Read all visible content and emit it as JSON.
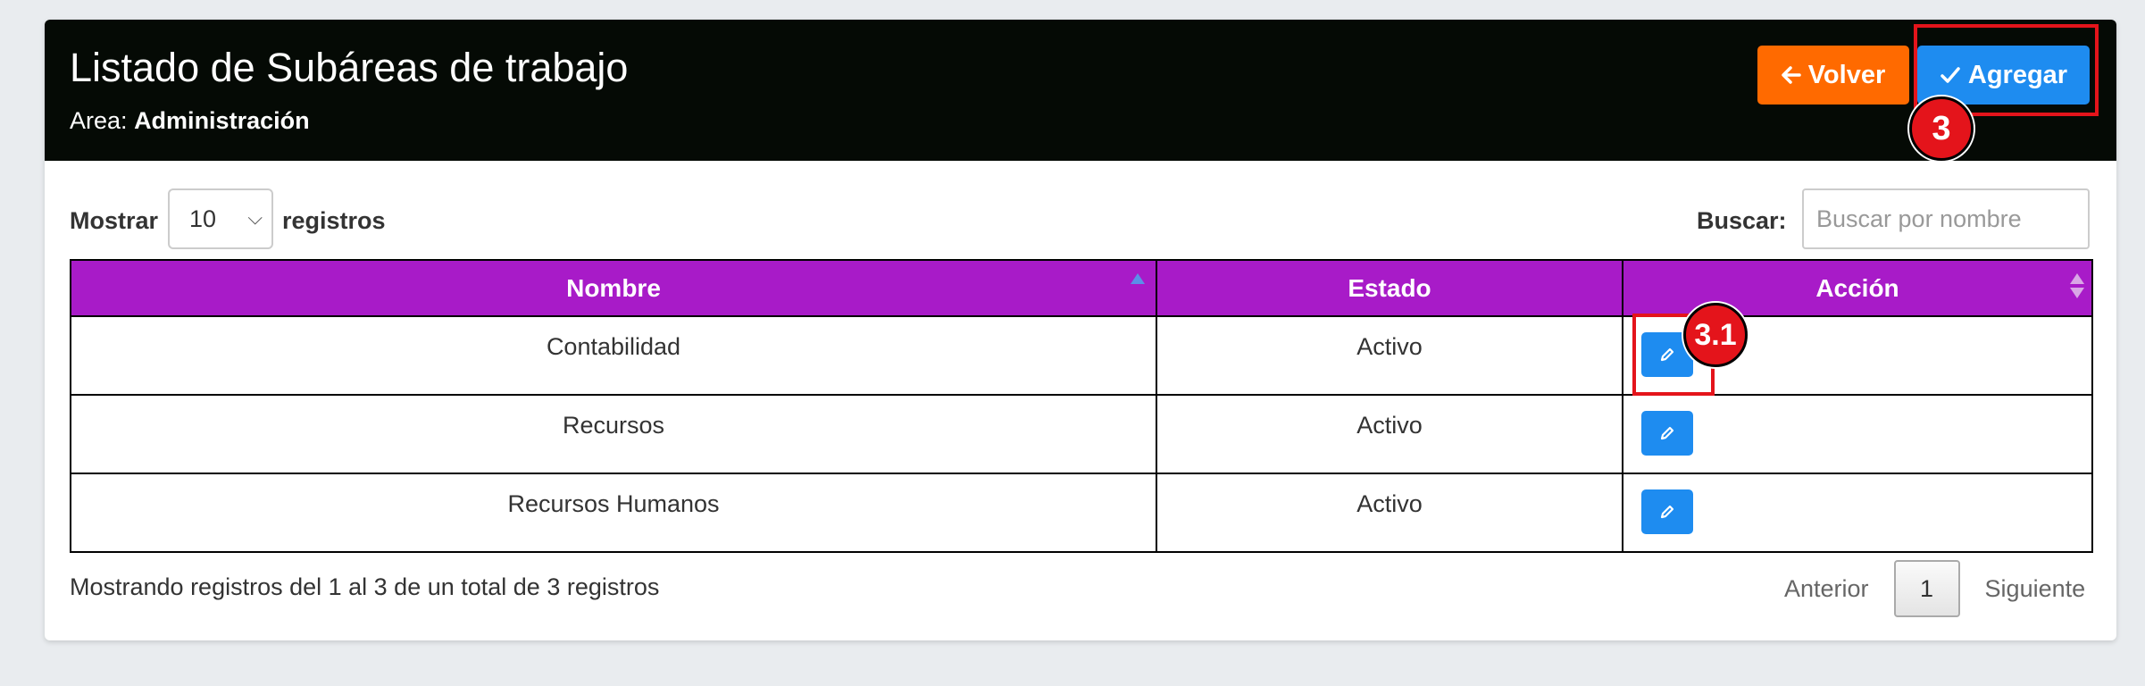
{
  "header": {
    "title": "Listado de Subáreas de trabajo",
    "area_label": "Area:",
    "area_value": "Administración",
    "back_button": "Volver",
    "add_button": "Agregar"
  },
  "annotations": {
    "badge_add": "3",
    "badge_edit": "3.1",
    "highlight_color": "#e4141b"
  },
  "controls": {
    "show_label": "Mostrar",
    "page_size": "10",
    "records_label": "registros",
    "search_label": "Buscar:",
    "search_placeholder": "Buscar por nombre",
    "search_value": ""
  },
  "table": {
    "columns": [
      "Nombre",
      "Estado",
      "Acción"
    ],
    "rows": [
      {
        "nombre": "Contabilidad",
        "estado": "Activo",
        "action_icon": "pencil-icon"
      },
      {
        "nombre": "Recursos",
        "estado": "Activo",
        "action_icon": "pencil-icon"
      },
      {
        "nombre": "Recursos Humanos",
        "estado": "Activo",
        "action_icon": "pencil-icon"
      }
    ],
    "header_color": "#a81bc8"
  },
  "footer": {
    "info": "Mostrando registros del 1 al 3 de un total de 3 registros",
    "prev": "Anterior",
    "page": "1",
    "next": "Siguiente"
  },
  "colors": {
    "back_button": "#ff6a00",
    "add_button": "#1e8cf0",
    "edit_button": "#1e8cf0",
    "header_bg": "#050a05"
  }
}
